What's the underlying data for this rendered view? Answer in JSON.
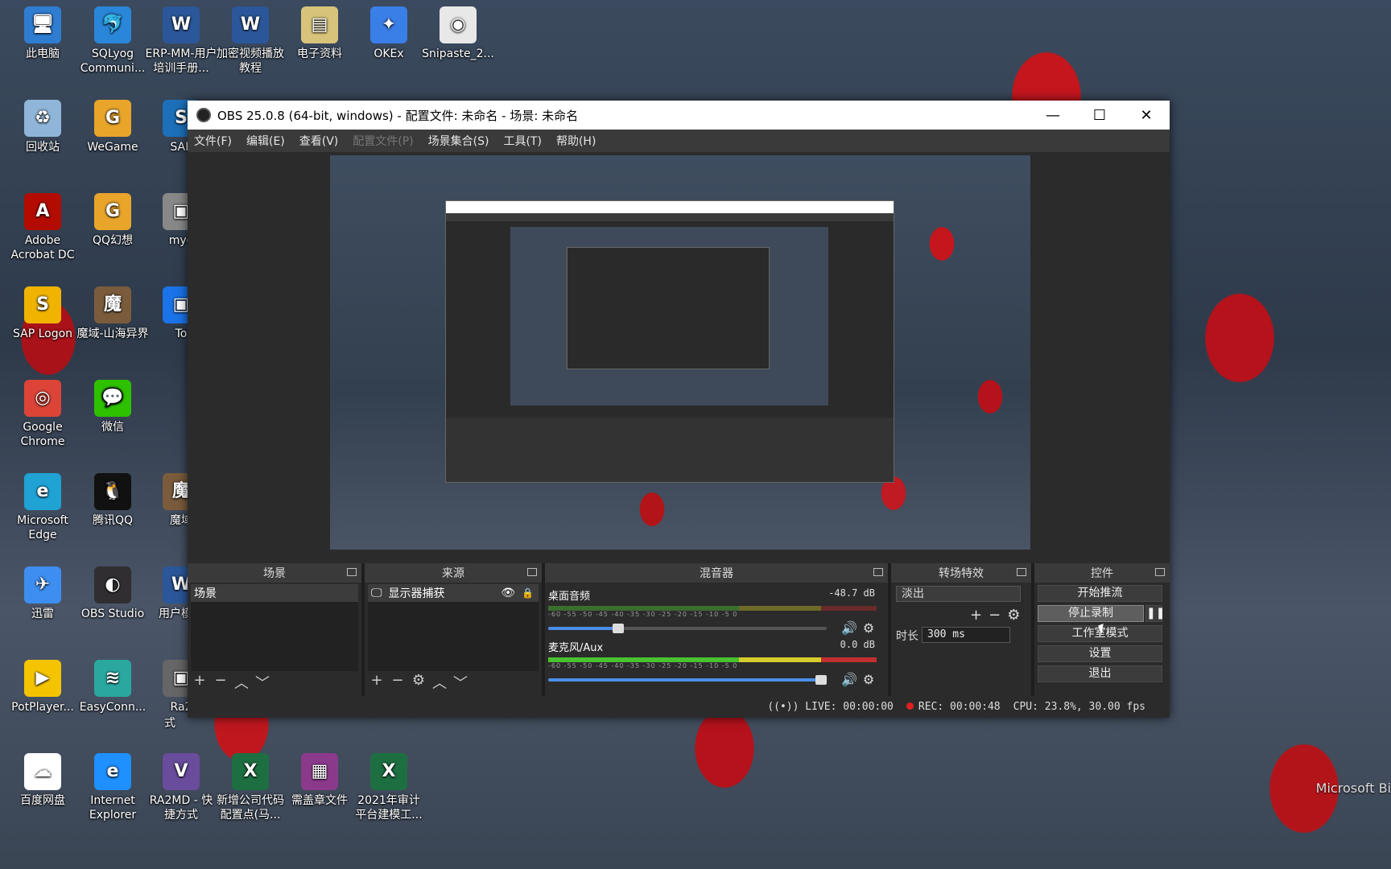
{
  "desktop": {
    "icons": [
      {
        "label": "此电脑",
        "icon": "computer-icon",
        "color": "#2f7dd1"
      },
      {
        "label": "SQLyog Communi...",
        "icon": "dolphin-icon",
        "color": "#2a86d9"
      },
      {
        "label": "ERP-MM-用户培训手册...",
        "icon": "word-doc-icon",
        "color": "#2b579a"
      },
      {
        "label": "加密视频播放教程",
        "icon": "word-doc-icon",
        "color": "#2b579a"
      },
      {
        "label": "电子资料",
        "icon": "folder-zip-icon",
        "color": "#d7c47a"
      },
      {
        "label": "OKEx",
        "icon": "okex-icon",
        "color": "#3a7ee8"
      },
      {
        "label": "Snipaste_2...",
        "icon": "image-file-icon",
        "color": "#e8e8e8"
      },
      {
        "label": "回收站",
        "icon": "recycle-bin-icon",
        "color": "#8fb6d8"
      },
      {
        "label": "WeGame",
        "icon": "wegame-icon",
        "color": "#e8a52a"
      },
      {
        "label": "SAP",
        "icon": "sap-icon",
        "color": "#1c6fb8"
      },
      {
        "label": "Adobe Acrobat DC",
        "icon": "acrobat-icon",
        "color": "#b30b00"
      },
      {
        "label": "QQ幻想",
        "icon": "qq-game-icon",
        "color": "#e8a52a"
      },
      {
        "label": "mye",
        "icon": "app-icon",
        "color": "#888888"
      },
      {
        "label": "SAP Logon",
        "icon": "sap-logon-icon",
        "color": "#f0b400"
      },
      {
        "label": "魔域-山海异界",
        "icon": "game-icon",
        "color": "#7a5c3c"
      },
      {
        "label": "To",
        "icon": "app-icon",
        "color": "#1a73e8"
      },
      {
        "label": "Google Chrome",
        "icon": "chrome-icon",
        "color": "#db4437"
      },
      {
        "label": "微信",
        "icon": "wechat-icon",
        "color": "#2dc100"
      },
      {
        "label": "Microsoft Edge",
        "icon": "edge-icon",
        "color": "#1fa2d4"
      },
      {
        "label": "腾讯QQ",
        "icon": "qq-icon",
        "color": "#111111"
      },
      {
        "label": "魔域",
        "icon": "game-icon",
        "color": "#7a5c3c"
      },
      {
        "label": "迅雷",
        "icon": "thunder-icon",
        "color": "#3d8ef0"
      },
      {
        "label": "OBS Studio",
        "icon": "obs-icon",
        "color": "#302e31"
      },
      {
        "label": "用户模板",
        "icon": "word-doc-icon",
        "color": "#2b579a"
      },
      {
        "label": "PotPlayer...",
        "icon": "potplayer-icon",
        "color": "#f5c400"
      },
      {
        "label": "EasyConn...",
        "icon": "easyconnect-icon",
        "color": "#2aa8a0"
      },
      {
        "label": "Ra2",
        "icon": "app-icon",
        "color": "#666666"
      },
      {
        "label": "百度网盘",
        "icon": "baidu-netdisk-icon",
        "color": "#ffffff"
      },
      {
        "label": "Internet Explorer",
        "icon": "ie-icon",
        "color": "#1e90ff"
      },
      {
        "label": "RA2MD - 快捷方式",
        "icon": "ra2md-icon",
        "color": "#6a4c9c"
      },
      {
        "label": "新增公司代码配置点(马...",
        "icon": "excel-icon",
        "color": "#1d6f42"
      },
      {
        "label": "需盖章文件",
        "icon": "winrar-icon",
        "color": "#8b3a8b"
      },
      {
        "label": "2021年审计平台建模工...",
        "icon": "excel-icon",
        "color": "#1d6f42"
      }
    ],
    "extra_label": "式",
    "watermark": "Microsoft Bi"
  },
  "obs": {
    "title": "OBS 25.0.8 (64-bit, windows) - 配置文件: 未命名 - 场景: 未命名",
    "window_buttons": {
      "minimize": "—",
      "maximize": "☐",
      "close": "✕"
    },
    "menu": [
      {
        "label": "文件(F)",
        "enabled": true
      },
      {
        "label": "编辑(E)",
        "enabled": true
      },
      {
        "label": "查看(V)",
        "enabled": true
      },
      {
        "label": "配置文件(P)",
        "enabled": false
      },
      {
        "label": "场景集合(S)",
        "enabled": true
      },
      {
        "label": "工具(T)",
        "enabled": true
      },
      {
        "label": "帮助(H)",
        "enabled": true
      }
    ],
    "docks": {
      "scenes": {
        "title": "场景",
        "items": [
          "场景"
        ]
      },
      "sources": {
        "title": "来源",
        "items": [
          "显示器捕获"
        ]
      },
      "mixer": {
        "title": "混音器",
        "tracks": [
          {
            "name": "桌面音频",
            "db": "-48.7 dB",
            "volume": 0.25
          },
          {
            "name": "麦克风/Aux",
            "db": "0.0 dB",
            "volume": 1.0
          }
        ],
        "scale": "-60 -55 -50 -45 -40 -35 -30 -25 -20 -15 -10 -5 0"
      },
      "transitions": {
        "title": "转场特效",
        "selected": "淡出",
        "duration_label": "时长",
        "duration_value": "300 ms"
      },
      "controls": {
        "title": "控件",
        "buttons": [
          "开始推流",
          "停止录制",
          "工作室模式",
          "设置",
          "退出"
        ],
        "pause": "❚❚"
      }
    },
    "status": {
      "live": "LIVE: 00:00:00",
      "rec": "REC: 00:00:48",
      "cpu": "CPU: 23.8%, 30.00 fps"
    }
  }
}
